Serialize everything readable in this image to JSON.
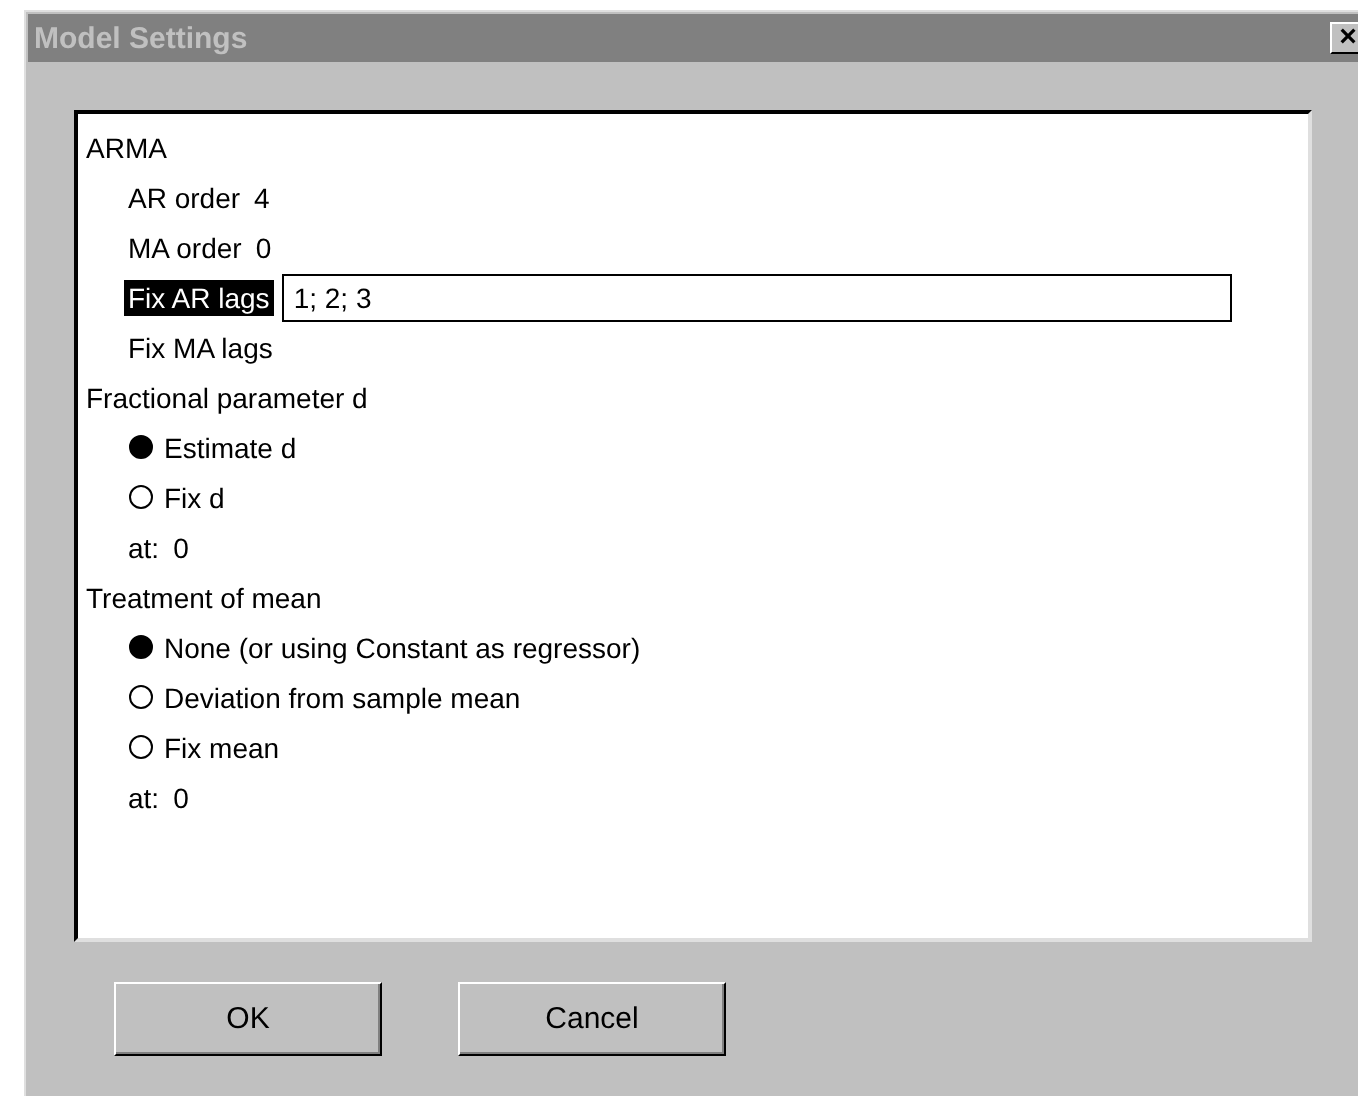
{
  "window": {
    "title": "Model Settings",
    "close": "×"
  },
  "sections": [
    {
      "label": "ARMA",
      "children": [
        {
          "kind": "value",
          "label": "AR order",
          "value": "4"
        },
        {
          "kind": "value",
          "label": "MA order",
          "value": "0"
        },
        {
          "kind": "field",
          "label": "Fix AR lags",
          "value": "1; 2; 3",
          "selected": true
        },
        {
          "kind": "label",
          "label": "Fix MA lags"
        }
      ]
    },
    {
      "label": "Fractional parameter d",
      "children": [
        {
          "kind": "radio",
          "label": "Estimate d",
          "selected": true
        },
        {
          "kind": "radio",
          "label": "Fix d",
          "selected": false
        },
        {
          "kind": "value",
          "label": "at:",
          "value": "0"
        }
      ]
    },
    {
      "label": "Treatment of mean",
      "children": [
        {
          "kind": "radio",
          "label": "None (or using Constant as regressor)",
          "selected": true
        },
        {
          "kind": "radio",
          "label": "Deviation from sample mean",
          "selected": false
        },
        {
          "kind": "radio",
          "label": "Fix mean",
          "selected": false
        },
        {
          "kind": "value",
          "label": "at:",
          "value": "0"
        }
      ]
    }
  ],
  "buttons": [
    "OK",
    "Cancel"
  ]
}
